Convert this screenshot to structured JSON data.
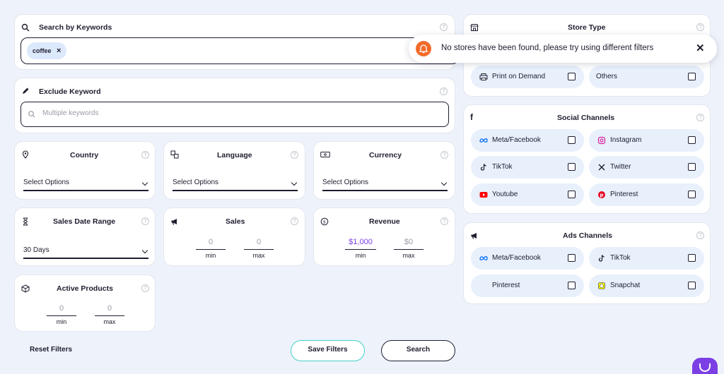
{
  "keywords": {
    "title": "Search by Keywords",
    "help": "?",
    "tag": "coffee",
    "tag_remove": "×"
  },
  "exclude": {
    "title": "Exclude Keyword",
    "help": "?",
    "placeholder": "Multiple keywords"
  },
  "country": {
    "title": "Country",
    "help": "?",
    "value": "Select Options"
  },
  "language": {
    "title": "Language",
    "help": "?",
    "value": "Select Options"
  },
  "currency": {
    "title": "Currency",
    "help": "?",
    "value": "Select Options"
  },
  "sales_date": {
    "title": "Sales Date Range",
    "help": "?",
    "value": "30 Days"
  },
  "sales": {
    "title": "Sales",
    "help": "?",
    "min_value": "0",
    "max_value": "0",
    "min_label": "min",
    "max_label": "max"
  },
  "revenue": {
    "title": "Revenue",
    "help": "?",
    "min_value": "$1,000",
    "max_value": "$0",
    "min_label": "min",
    "max_label": "max"
  },
  "active_products": {
    "title": "Active Products",
    "help": "?",
    "min_value": "0",
    "max_value": "0",
    "min_label": "min",
    "max_label": "max"
  },
  "footer": {
    "reset": "Reset Filters",
    "save": "Save Filters",
    "search": "Search"
  },
  "store_type": {
    "title": "Store Type",
    "help": "?",
    "items": [
      "Print on Demand",
      "Others"
    ]
  },
  "social": {
    "title": "Social Channels",
    "help": "?",
    "items": [
      "Meta/Facebook",
      "Instagram",
      "TikTok",
      "Twitter",
      "Youtube",
      "Pinterest"
    ]
  },
  "ads": {
    "title": "Ads Channels",
    "help": "?",
    "items": [
      "Meta/Facebook",
      "TikTok",
      "Pinterest",
      "Snapchat"
    ]
  },
  "toast": {
    "message": "No stores have been found, please try using different filters",
    "close": "✕"
  },
  "colors": {
    "accent": "#7b3fe4",
    "toast_icon": "#f26b2a",
    "save_border": "#3fd0c9",
    "dark": "#1d1d2f",
    "chip_bg": "#e8f0fc"
  }
}
